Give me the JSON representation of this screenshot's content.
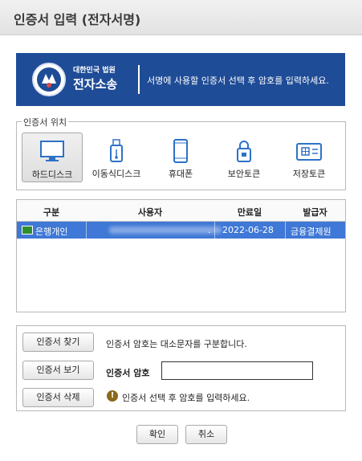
{
  "window": {
    "title": "인증서 입력 (전자서명)"
  },
  "banner": {
    "org": "대한민국 법원",
    "service": "전자소송",
    "message": "서명에 사용할 인증서 선택 후 암호를 입력하세요.",
    "color": "#1f4c97"
  },
  "location": {
    "legend": "인증서 위치",
    "items": [
      {
        "label": "하드디스크",
        "icon": "monitor-icon",
        "selected": true
      },
      {
        "label": "이동식디스크",
        "icon": "usb-icon",
        "selected": false
      },
      {
        "label": "휴대폰",
        "icon": "phone-icon",
        "selected": false
      },
      {
        "label": "보안토큰",
        "icon": "lock-token-icon",
        "selected": false
      },
      {
        "label": "저장토큰",
        "icon": "smartcard-icon",
        "selected": false
      }
    ]
  },
  "certs": {
    "columns": [
      "구분",
      "사용자",
      "만료일",
      "발급자"
    ],
    "rows": [
      {
        "type": "은행개인",
        "user": ".",
        "expiry": "2022-06-28",
        "issuer": "금융결제원",
        "selected": true
      }
    ],
    "selected_color": "#3f78d6"
  },
  "actions": {
    "find_label": "인증서 찾기",
    "view_label": "인증서 보기",
    "delete_label": "인증서 삭제",
    "case_note": "인증서 암호는 대소문자를 구분합니다.",
    "password_label": "인증서 암호",
    "password_value": "",
    "warning": "인증서 선택 후 암호를 입력하세요."
  },
  "footer": {
    "ok_label": "확인",
    "cancel_label": "취소"
  }
}
